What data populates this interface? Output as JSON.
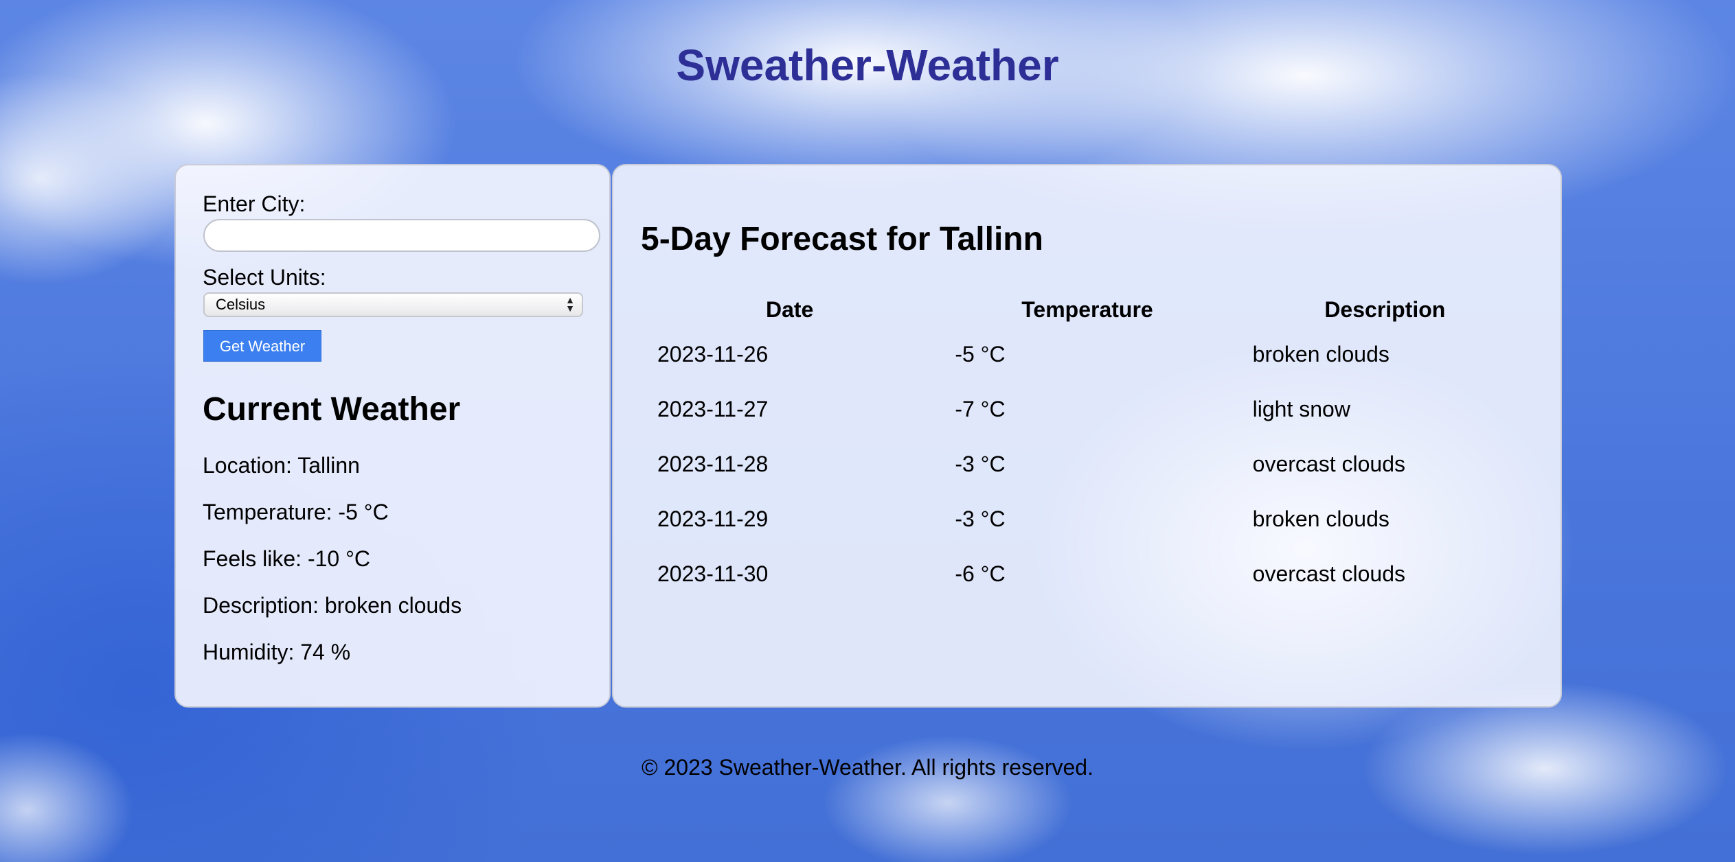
{
  "header": {
    "title": "Sweather-Weather"
  },
  "search": {
    "city_label": "Enter City:",
    "city_value": "",
    "units_label": "Select Units:",
    "units_selected": "Celsius",
    "button_label": "Get Weather"
  },
  "current": {
    "title": "Current Weather",
    "location": "Location: Tallinn",
    "temperature": "Temperature: -5 °C",
    "feels_like": "Feels like: -10 °C",
    "description": "Description: broken clouds",
    "humidity": "Humidity: 74 %"
  },
  "forecast": {
    "title": "5-Day Forecast for Tallinn",
    "headers": [
      "Date",
      "Temperature",
      "Description"
    ],
    "rows": [
      {
        "date": "2023-11-26",
        "temp": "-5 °C",
        "desc": "broken clouds"
      },
      {
        "date": "2023-11-27",
        "temp": "-7 °C",
        "desc": "light snow"
      },
      {
        "date": "2023-11-28",
        "temp": "-3 °C",
        "desc": "overcast clouds"
      },
      {
        "date": "2023-11-29",
        "temp": "-3 °C",
        "desc": "broken clouds"
      },
      {
        "date": "2023-11-30",
        "temp": "-6 °C",
        "desc": "overcast clouds"
      }
    ]
  },
  "footer": {
    "text": "© 2023 Sweather-Weather. All rights reserved."
  },
  "colors": {
    "title": "#2e2f96",
    "button": "#3b7ff0",
    "sky": "#4d79e0"
  }
}
